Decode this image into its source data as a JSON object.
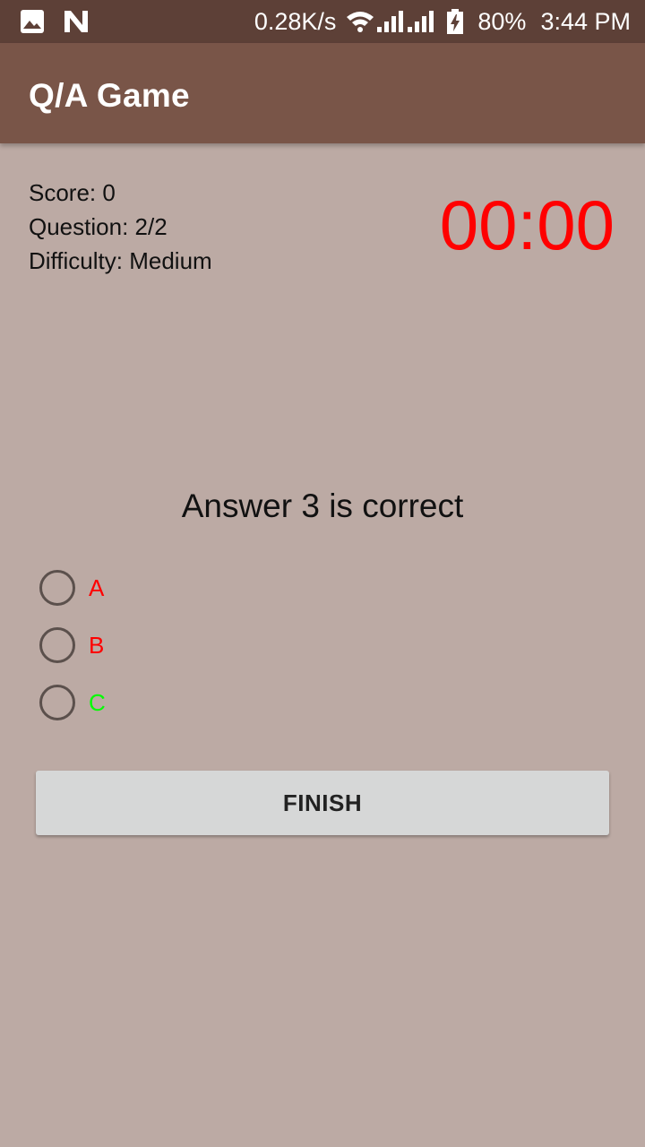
{
  "status_bar": {
    "network_speed": "0.28K/s",
    "battery": "80%",
    "time": "3:44 PM",
    "icons": [
      "image-icon",
      "n-logo-icon",
      "wifi-icon",
      "signal-icon",
      "signal-icon",
      "battery-charging-icon"
    ]
  },
  "app_bar": {
    "title": "Q/A Game",
    "color": "#795548"
  },
  "game": {
    "score": "Score: 0",
    "question_num": "Question: 2/2",
    "difficulty": "Difficulty: Medium",
    "timer": "00:00",
    "timer_color": "#ff0000"
  },
  "question": {
    "text": "Answer 3 is correct"
  },
  "options": [
    {
      "label": "A",
      "color": "#ff0000"
    },
    {
      "label": "B",
      "color": "#ff0000"
    },
    {
      "label": "C",
      "color": "#00ff00"
    }
  ],
  "finish_button": {
    "label": "FINISH"
  }
}
